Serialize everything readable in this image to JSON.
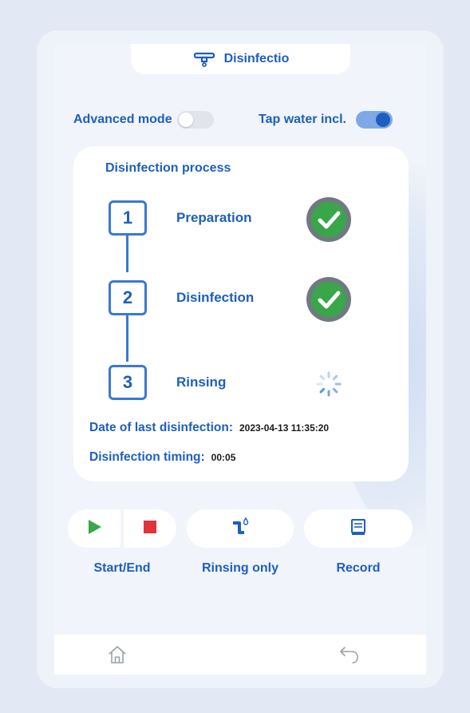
{
  "header": {
    "title": "Disinfectio",
    "icon": "faucet-icon"
  },
  "toggles": {
    "advanced_mode": {
      "label": "Advanced mode",
      "on": false
    },
    "tap_water": {
      "label": "Tap water incl.",
      "on": true
    }
  },
  "process": {
    "title": "Disinfection process",
    "steps": [
      {
        "number": "1",
        "label": "Preparation",
        "status": "done"
      },
      {
        "number": "2",
        "label": "Disinfection",
        "status": "done"
      },
      {
        "number": "3",
        "label": "Rinsing",
        "status": "in-progress"
      }
    ],
    "last_disinfection_label": "Date of last disinfection:",
    "last_disinfection_value": "2023-04-13 11:35:20",
    "timing_label": "Disinfection timing:",
    "timing_value": "00:05"
  },
  "actions": {
    "start_end": "Start/End",
    "rinsing_only": "Rinsing only",
    "record": "Record"
  },
  "colors": {
    "accent": "#1d5fbf",
    "success": "#3aa64a",
    "start": "#3aa64a",
    "stop": "#e0333b"
  },
  "nav": {
    "home_icon": "home-icon",
    "back_icon": "back-arrow-icon"
  }
}
